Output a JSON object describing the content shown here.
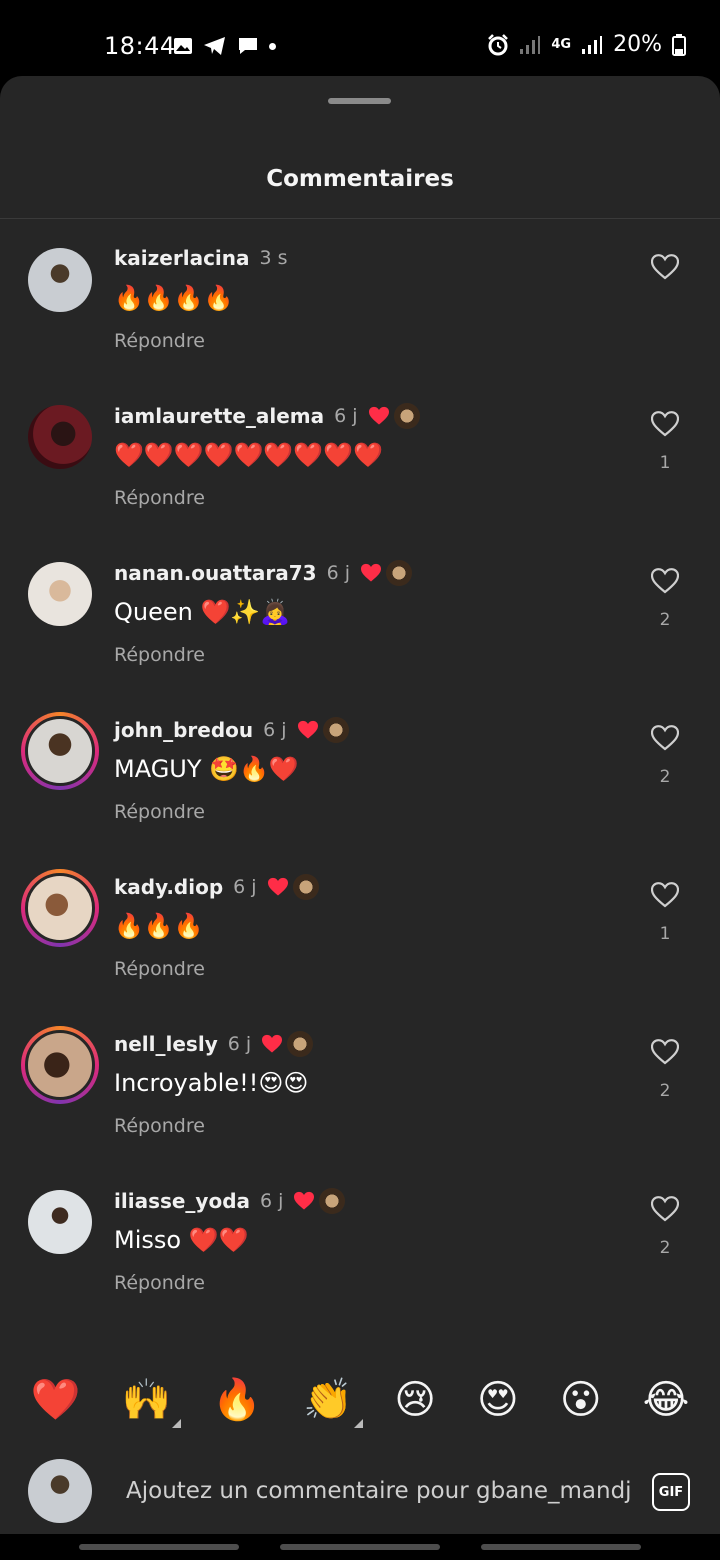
{
  "status_bar": {
    "time": "18:44",
    "network": "4G",
    "battery": "20%"
  },
  "sheet": {
    "title": "Commentaires"
  },
  "comments": [
    {
      "username": "kaizerlacina",
      "time": "3 s",
      "text": "🔥🔥🔥🔥",
      "reply": "Répondre",
      "likes": "",
      "creator_liked": false
    },
    {
      "username": "iamlaurette_alema",
      "time": "6 j",
      "text": "❤️❤️❤️❤️❤️❤️❤️❤️❤️",
      "reply": "Répondre",
      "likes": "1",
      "creator_liked": true
    },
    {
      "username": "nanan.ouattara73",
      "time": "6 j",
      "text": "Queen ❤️✨🙇‍♀️",
      "reply": "Répondre",
      "likes": "2",
      "creator_liked": true
    },
    {
      "username": "john_bredou",
      "time": "6 j",
      "text": "MAGUY 🤩🔥❤️",
      "reply": "Répondre",
      "likes": "2",
      "creator_liked": true
    },
    {
      "username": "kady.diop",
      "time": "6 j",
      "text": "🔥🔥🔥",
      "reply": "Répondre",
      "likes": "1",
      "creator_liked": true
    },
    {
      "username": "nell_lesly",
      "time": "6 j",
      "text": "Incroyable!!😍😍",
      "reply": "Répondre",
      "likes": "2",
      "creator_liked": true
    },
    {
      "username": "iliasse_yoda",
      "time": "6 j",
      "text": "Misso ❤️❤️",
      "reply": "Répondre",
      "likes": "2",
      "creator_liked": true
    }
  ],
  "emoji_bar": [
    "❤️",
    "🙌",
    "🔥",
    "👏",
    "😢",
    "😍",
    "😮",
    "😂"
  ],
  "input": {
    "placeholder": "Ajoutez un commentaire pour gbane_mandj",
    "gif_label": "GIF"
  }
}
